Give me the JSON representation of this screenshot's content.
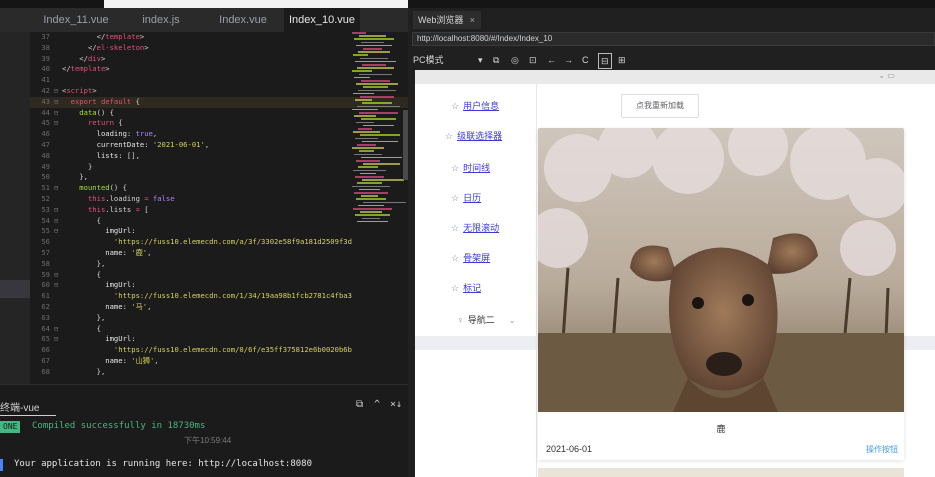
{
  "editor": {
    "tabs": [
      {
        "label": "Index_11.vue",
        "active": false
      },
      {
        "label": "index.js",
        "active": false
      },
      {
        "label": "Index.vue",
        "active": false
      },
      {
        "label": "Index_10.vue",
        "active": true
      }
    ],
    "lines": [
      {
        "n": "37",
        "f": "",
        "parts": [
          [
            "pun",
            "        </"
          ],
          [
            "tag",
            "template"
          ],
          [
            "pun",
            ">"
          ]
        ]
      },
      {
        "n": "38",
        "f": "",
        "parts": [
          [
            "pun",
            "      </"
          ],
          [
            "tag",
            "el-skeleton"
          ],
          [
            "pun",
            ">"
          ]
        ]
      },
      {
        "n": "39",
        "f": "",
        "parts": [
          [
            "pun",
            "    </"
          ],
          [
            "tag",
            "div"
          ],
          [
            "pun",
            ">"
          ]
        ]
      },
      {
        "n": "40",
        "f": "",
        "parts": [
          [
            "pun",
            "</"
          ],
          [
            "tag",
            "template"
          ],
          [
            "pun",
            ">"
          ]
        ]
      },
      {
        "n": "41",
        "f": "",
        "parts": []
      },
      {
        "n": "42",
        "f": "⊟",
        "parts": [
          [
            "pun",
            "<"
          ],
          [
            "tag",
            "script"
          ],
          [
            "pun",
            ">"
          ]
        ]
      },
      {
        "n": "43",
        "f": "⊟",
        "hl": true,
        "parts": [
          [
            "kw",
            "  export default "
          ],
          [
            "pun",
            "{"
          ]
        ]
      },
      {
        "n": "44",
        "f": "⊟",
        "parts": [
          [
            "fn",
            "    data"
          ],
          [
            "pun",
            "() {"
          ]
        ]
      },
      {
        "n": "45",
        "f": "⊟",
        "parts": [
          [
            "kw",
            "      return "
          ],
          [
            "pun",
            "{"
          ]
        ]
      },
      {
        "n": "46",
        "f": "",
        "parts": [
          [
            "prop",
            "        loading: "
          ],
          [
            "bool",
            "true"
          ],
          [
            "pun",
            ","
          ]
        ]
      },
      {
        "n": "47",
        "f": "",
        "parts": [
          [
            "prop",
            "        currentDate: "
          ],
          [
            "str",
            "'2021-06-01'"
          ],
          [
            "pun",
            ","
          ]
        ]
      },
      {
        "n": "48",
        "f": "",
        "parts": [
          [
            "prop",
            "        lists: "
          ],
          [
            "pun",
            "[],"
          ]
        ]
      },
      {
        "n": "49",
        "f": "",
        "parts": [
          [
            "pun",
            "      }"
          ]
        ]
      },
      {
        "n": "50",
        "f": "",
        "parts": [
          [
            "pun",
            "    },"
          ]
        ]
      },
      {
        "n": "51",
        "f": "⊟",
        "parts": [
          [
            "fn",
            "    mounted"
          ],
          [
            "pun",
            "() {"
          ]
        ]
      },
      {
        "n": "52",
        "f": "",
        "parts": [
          [
            "kw",
            "      this"
          ],
          [
            "pun",
            ".loading "
          ],
          [
            "kw",
            "="
          ],
          [
            "bool",
            " false"
          ]
        ]
      },
      {
        "n": "53",
        "f": "⊟",
        "parts": [
          [
            "kw",
            "      this"
          ],
          [
            "pun",
            ".lists "
          ],
          [
            "kw",
            "="
          ],
          [
            "pun",
            " ["
          ]
        ]
      },
      {
        "n": "54",
        "f": "⊟",
        "parts": [
          [
            "pun",
            "        {"
          ]
        ]
      },
      {
        "n": "55",
        "f": "⊟",
        "parts": [
          [
            "prop",
            "          imgUrl:"
          ]
        ]
      },
      {
        "n": "56",
        "f": "",
        "parts": [
          [
            "str",
            "            'https://fuss10.elemecdn.com/a/3f/3302e58f9a181d2509f3d"
          ]
        ]
      },
      {
        "n": "57",
        "f": "",
        "parts": [
          [
            "prop",
            "          name: "
          ],
          [
            "str",
            "'鹿'"
          ],
          [
            "pun",
            ","
          ]
        ]
      },
      {
        "n": "58",
        "f": "",
        "parts": [
          [
            "pun",
            "        },"
          ]
        ]
      },
      {
        "n": "59",
        "f": "⊟",
        "parts": [
          [
            "pun",
            "        {"
          ]
        ]
      },
      {
        "n": "60",
        "f": "⊟",
        "parts": [
          [
            "prop",
            "          imgUrl:"
          ]
        ]
      },
      {
        "n": "61",
        "f": "",
        "parts": [
          [
            "str",
            "            'https://fuss10.elemecdn.com/1/34/19aa98b1fcb2781c4fba3"
          ]
        ]
      },
      {
        "n": "62",
        "f": "",
        "parts": [
          [
            "prop",
            "          name: "
          ],
          [
            "str",
            "'马'"
          ],
          [
            "pun",
            ","
          ]
        ]
      },
      {
        "n": "63",
        "f": "",
        "parts": [
          [
            "pun",
            "        },"
          ]
        ]
      },
      {
        "n": "64",
        "f": "⊟",
        "parts": [
          [
            "pun",
            "        {"
          ]
        ]
      },
      {
        "n": "65",
        "f": "⊟",
        "parts": [
          [
            "prop",
            "          imgUrl:"
          ]
        ]
      },
      {
        "n": "66",
        "f": "",
        "parts": [
          [
            "str",
            "            'https://fuss10.elemecdn.com/0/6f/e35ff375812e6b0020b6b"
          ]
        ]
      },
      {
        "n": "67",
        "f": "",
        "parts": [
          [
            "prop",
            "          name: "
          ],
          [
            "str",
            "'山狮'"
          ],
          [
            "pun",
            ","
          ]
        ]
      },
      {
        "n": "68",
        "f": "",
        "parts": [
          [
            "pun",
            "        },"
          ]
        ]
      }
    ]
  },
  "terminal": {
    "title": "终端-vue",
    "controls": [
      "⧉",
      "^",
      "×↓"
    ],
    "badge": "ONE",
    "compiled": "Compiled successfully in 18730ms",
    "timestamp": "下午10:59:44",
    "running": "Your application is running here: http://localhost:8080"
  },
  "browser": {
    "tab_title": "Web浏览器",
    "tab_close": "×",
    "url": "http://localhost:8080/#/Index/Index_10",
    "mode": "PC模式",
    "tool_icons": [
      "▾",
      "⧉",
      "◎",
      "⊡",
      "←",
      "→",
      "C",
      "⊟",
      "⊞"
    ],
    "menu": [
      {
        "label": "用户信息",
        "link": true
      },
      {
        "label": "级联选择器",
        "link": true
      },
      {
        "label": "时间线",
        "link": true
      },
      {
        "label": "日历",
        "link": true
      },
      {
        "label": "无限滚动",
        "link": true
      },
      {
        "label": "骨架屏",
        "link": true
      },
      {
        "label": "标记",
        "link": true
      },
      {
        "label": "导航二",
        "link": false
      }
    ],
    "reload_button": "点我重新加载",
    "card": {
      "name": "鹿",
      "date": "2021-06-01",
      "action": "操作按钮"
    }
  },
  "colors": {
    "accent": "#409eff",
    "terminal_green": "#45b783",
    "tag_pink": "#e2507a",
    "string_yellow": "#d6d35a"
  }
}
